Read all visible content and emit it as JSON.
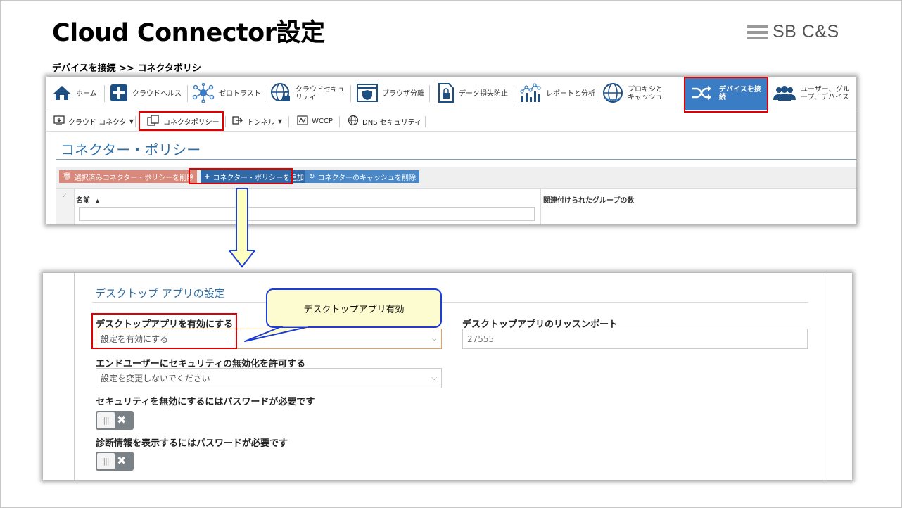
{
  "slide": {
    "title": "Cloud Connector設定",
    "breadcrumb": "デバイスを接続 >> コネクタポリシ",
    "logo": "SB C&S"
  },
  "topnav": {
    "items": [
      {
        "label": "ホーム",
        "icon": "home-icon"
      },
      {
        "label": "クラウドヘルス",
        "icon": "plus-square-icon"
      },
      {
        "label": "ゼロトラスト",
        "icon": "network-node-icon"
      },
      {
        "label": "クラウドセキュリティ",
        "icon": "globe-lock-icon"
      },
      {
        "label": "ブラウザ分離",
        "icon": "browser-shield-icon"
      },
      {
        "label": "データ損失防止",
        "icon": "document-lock-icon"
      },
      {
        "label": "レポートと分析",
        "icon": "analytics-icon"
      },
      {
        "label": "プロキシとキャッシュ",
        "icon": "proxy-globe-icon"
      },
      {
        "label": "デバイスを接続",
        "icon": "shuffle-icon"
      },
      {
        "label": "ユーザー、グループ、デバイス",
        "icon": "users-icon"
      }
    ]
  },
  "subnav": {
    "items": [
      {
        "label": "クラウド コネクタ",
        "icon": "download-monitor-icon"
      },
      {
        "label": "コネクタポリシー",
        "icon": "policy-copy-icon"
      },
      {
        "label": "トンネル",
        "icon": "arrow-right-box-icon"
      },
      {
        "label": "WCCP",
        "icon": "wave-icon"
      },
      {
        "label": "DNS セキュリティ",
        "icon": "dns-globe-icon"
      }
    ]
  },
  "page": {
    "heading": "コネクター・ポリシー",
    "actions": {
      "delete": "選択済みコネクター・ポリシーを削除",
      "add": "コネクター・ポリシーを追加",
      "clear_cache": "コネクターのキャッシュを削除"
    },
    "table": {
      "col_name": "名前",
      "col_groups": "関連付けられたグループの数"
    }
  },
  "settings": {
    "section_title": "デスクトップ アプリの設定",
    "enable_label": "デスクトップアプリを有効にする",
    "enable_value": "設定を有効にする",
    "port_label": "デスクトップアプリのリッスンポート",
    "port_value": "27555",
    "allow_disable_label": "エンドユーザーにセキュリティの無効化を許可する",
    "allow_disable_value": "設定を変更しないでください",
    "password_disable_label": "セキュリティを無効にするにはパスワードが必要です",
    "password_diag_label": "診断情報を表示するにはパスワードが必要です"
  },
  "callout": {
    "text": "デスクトップアプリ有効"
  },
  "colors": {
    "highlight": "#e00000",
    "accent_blue": "#3b7dc4",
    "callout_border": "#1e3cd6",
    "callout_fill": "#fcfcd0"
  }
}
